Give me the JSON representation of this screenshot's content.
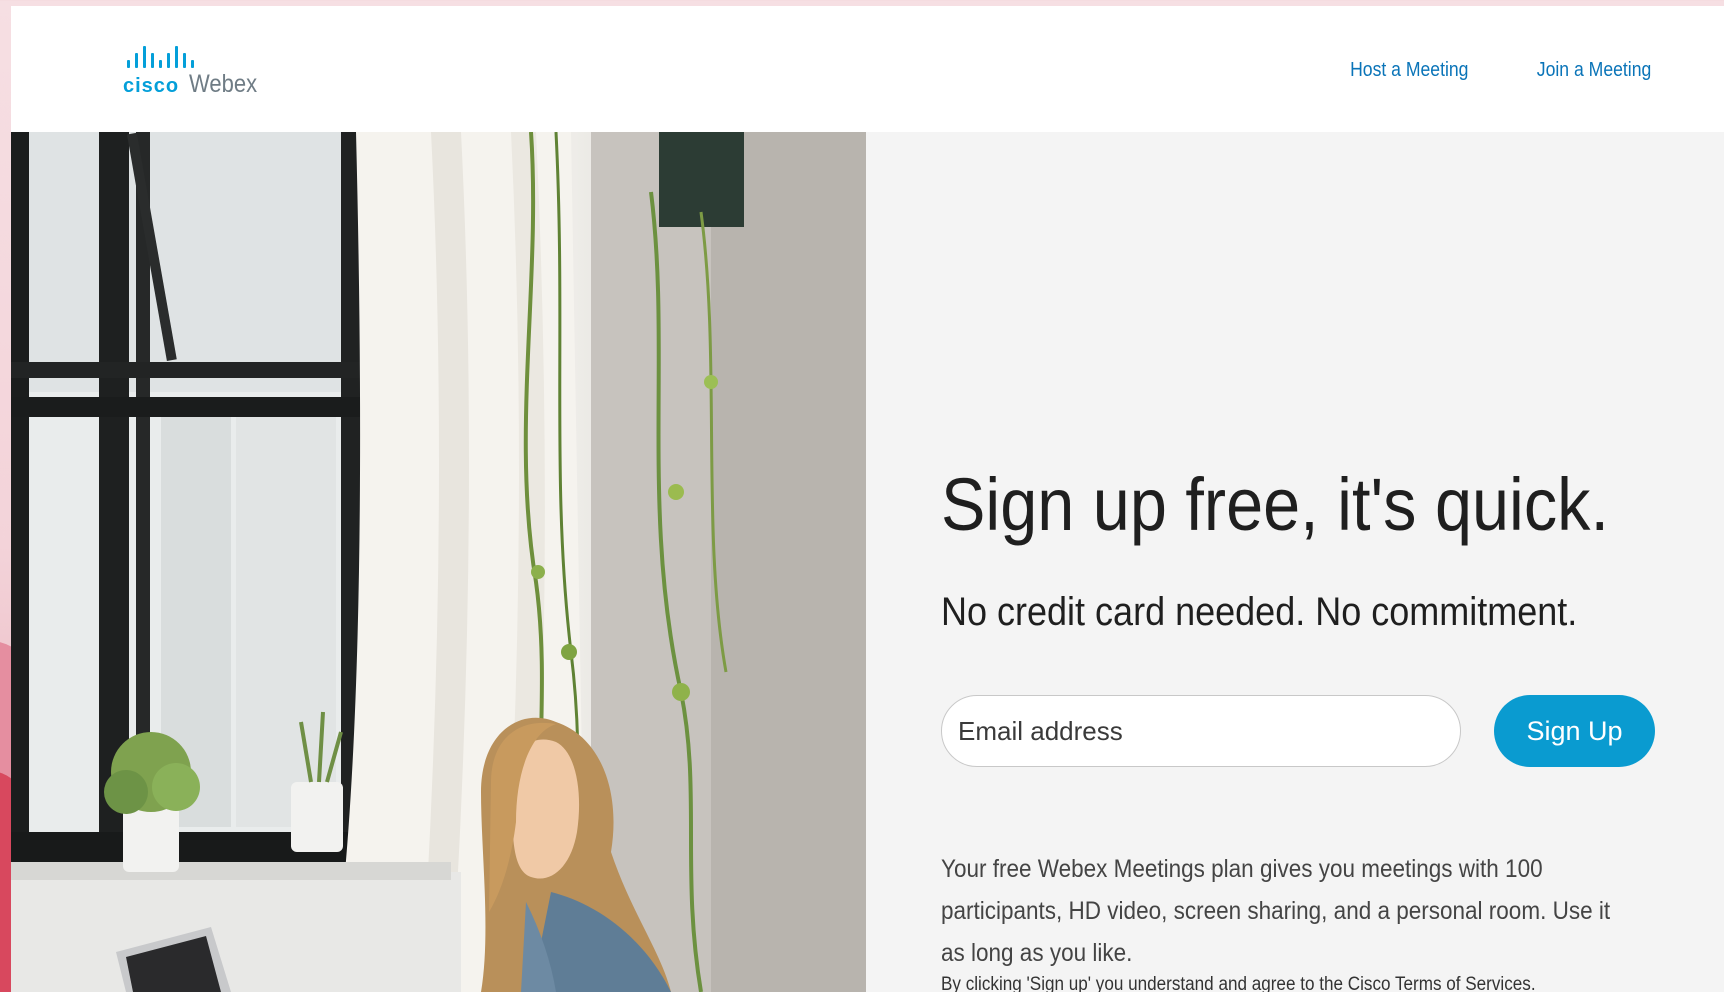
{
  "header": {
    "logo_cisco": "cisco",
    "logo_product": "Webex",
    "nav": [
      {
        "label": "Host a Meeting"
      },
      {
        "label": "Join a Meeting"
      }
    ]
  },
  "hero": {
    "headline": "Sign up free, it's quick.",
    "subheadline": "No credit card needed. No commitment.",
    "email_placeholder": "Email address",
    "email_value": "",
    "signup_label": "Sign Up",
    "description": "Your free Webex Meetings plan gives you meetings with 100 participants, HD video, screen sharing, and a personal room. Use it as long as you like.",
    "terms_prefix": "By clicking 'Sign up' you understand and agree to the ",
    "terms_link": "Cisco Terms of Services",
    "terms_suffix": "."
  },
  "colors": {
    "brand_blue": "#049fd9",
    "button_blue": "#0a9bd0",
    "link_blue": "#0a74b8",
    "panel_bg": "#f4f4f4",
    "outer_bg": "#f3d3d9"
  },
  "photo": {
    "subject": "woman-with-laptop-by-window"
  }
}
